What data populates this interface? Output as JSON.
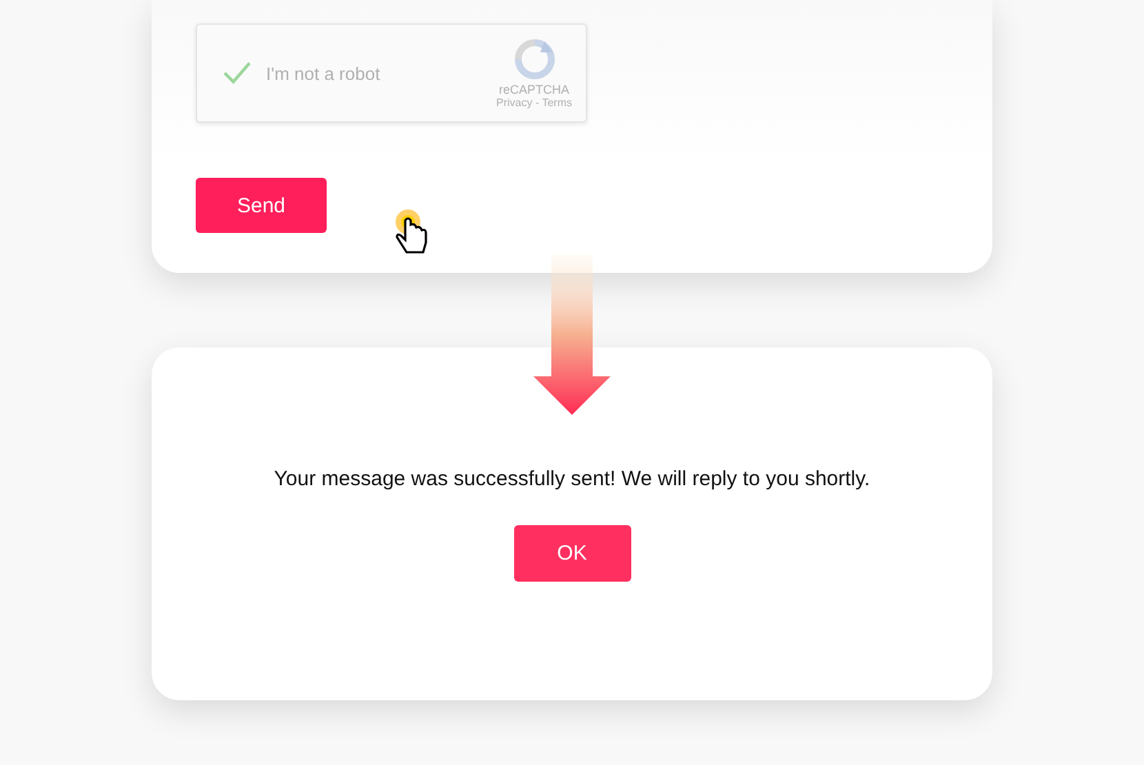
{
  "form_card": {
    "captcha": {
      "label": "I'm not a robot",
      "checked": true,
      "brand": "reCAPTCHA",
      "links": "Privacy - Terms"
    },
    "send_button": "Send"
  },
  "dialog": {
    "message": "Your message was successfully sent! We will reply to you shortly.",
    "ok_button": "OK"
  }
}
